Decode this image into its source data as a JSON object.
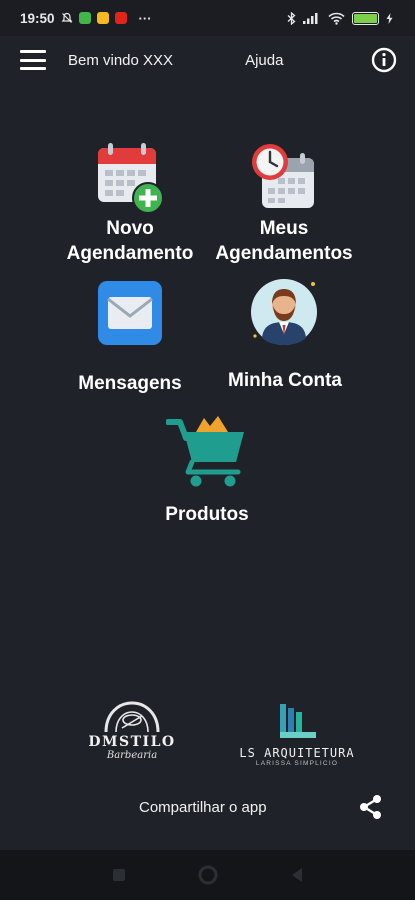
{
  "status_bar": {
    "time": "19:50",
    "overflow": "···",
    "battery_icon": "battery-charging-icon"
  },
  "header": {
    "welcome": "Bem vindo XXX",
    "help": "Ajuda",
    "menu_icon": "hamburger-menu-icon",
    "info_icon": "info-icon"
  },
  "tiles": [
    {
      "line1": "Novo",
      "line2": "Agendamento",
      "icon": "calendar-add-icon"
    },
    {
      "line1": "Meus",
      "line2": "Agendamentos",
      "icon": "calendar-clock-icon"
    },
    {
      "line1": "Mensagens",
      "icon": "envelope-icon"
    },
    {
      "line1": "Minha Conta",
      "icon": "user-avatar-icon"
    },
    {
      "line1": "Produtos",
      "icon": "shopping-cart-icon"
    }
  ],
  "footer": {
    "logo_left": {
      "top": "DMSTILO",
      "bottom": "Barbearia"
    },
    "logo_right": {
      "top": "LS ARQUITETURA",
      "bottom": "LARISSA SIMPLICIO"
    },
    "share_text": "Compartilhar o app",
    "share_icon": "share-icon"
  },
  "colors": {
    "background": "#1f2228",
    "calendar_red": "#e23b3b",
    "plus_green": "#3fb34f",
    "mail_blue": "#2f8be6",
    "cart_teal": "#1f9d8f",
    "cart_gold": "#f0a32c"
  }
}
